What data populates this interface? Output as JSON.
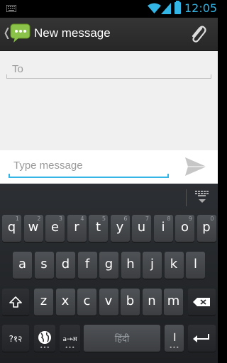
{
  "status_bar": {
    "time": "12:05",
    "icons": [
      "notification-icon",
      "wifi-icon",
      "signal-icon",
      "battery-icon"
    ]
  },
  "action_bar": {
    "title": "New message",
    "back_glyph": "❬",
    "attach_icon": "paperclip-icon"
  },
  "compose": {
    "to_placeholder": "To",
    "message_placeholder": "Type message",
    "send_icon": "send-icon"
  },
  "keyboard": {
    "row1": [
      {
        "k": "q",
        "h": "1"
      },
      {
        "k": "w",
        "h": "2"
      },
      {
        "k": "e",
        "h": "3"
      },
      {
        "k": "r",
        "h": "4"
      },
      {
        "k": "t",
        "h": "5"
      },
      {
        "k": "y",
        "h": "6"
      },
      {
        "k": "u",
        "h": "7"
      },
      {
        "k": "i",
        "h": "8"
      },
      {
        "k": "o",
        "h": "9"
      },
      {
        "k": "p",
        "h": "0"
      }
    ],
    "row2": [
      "a",
      "s",
      "d",
      "f",
      "g",
      "h",
      "j",
      "k",
      "l"
    ],
    "row3": [
      "z",
      "x",
      "c",
      "v",
      "b",
      "n",
      "m"
    ],
    "symbols_label": "?१२",
    "translit_label": "a→अ",
    "space_label": "हिंदी",
    "period_label": "।",
    "colors": {
      "accent": "#33b5e5",
      "key": "#45484b",
      "key_dark": "#2a2c2f"
    }
  }
}
